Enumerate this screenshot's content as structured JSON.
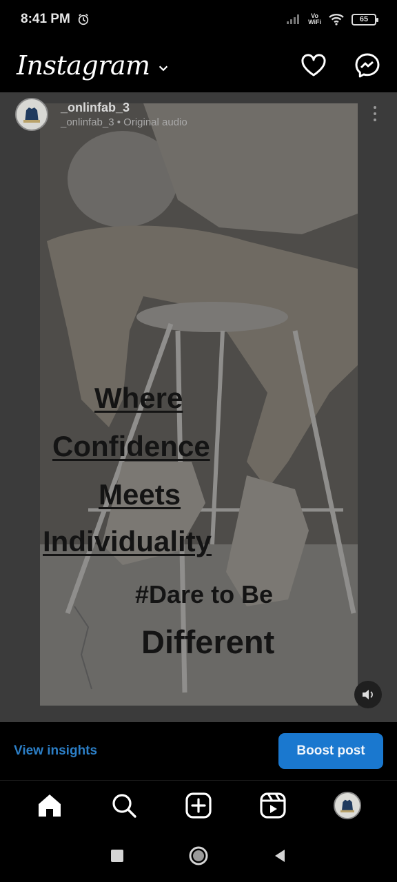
{
  "status_bar": {
    "time": "8:41 PM",
    "vo_wifi_top": "Vo",
    "vo_wifi_bottom": "WiFi",
    "battery": "65",
    "icons": [
      "alarm-icon",
      "signal-icon",
      "wifi-icon",
      "battery-icon"
    ]
  },
  "header": {
    "logo": "Instagram",
    "icons": [
      "chevron-down-icon",
      "heart-icon",
      "messenger-icon"
    ]
  },
  "post": {
    "username": "_onlinfab_3",
    "audio": "_onlinfab_3 • Original audio",
    "caption_lines": [
      "Where",
      "Confidence",
      "Meets",
      "Individuality",
      "#Dare to Be",
      "Different"
    ],
    "icons": [
      "more-vertical-icon",
      "volume-icon"
    ]
  },
  "actions": {
    "insights_label": "View insights",
    "boost_label": "Boost post",
    "accent": "#1a78cf"
  },
  "bottom_nav": {
    "items": [
      "home-icon",
      "search-icon",
      "create-icon",
      "reels-icon",
      "profile-avatar"
    ]
  },
  "system_nav": {
    "items": [
      "recents-icon",
      "home-circle-icon",
      "back-icon"
    ]
  }
}
